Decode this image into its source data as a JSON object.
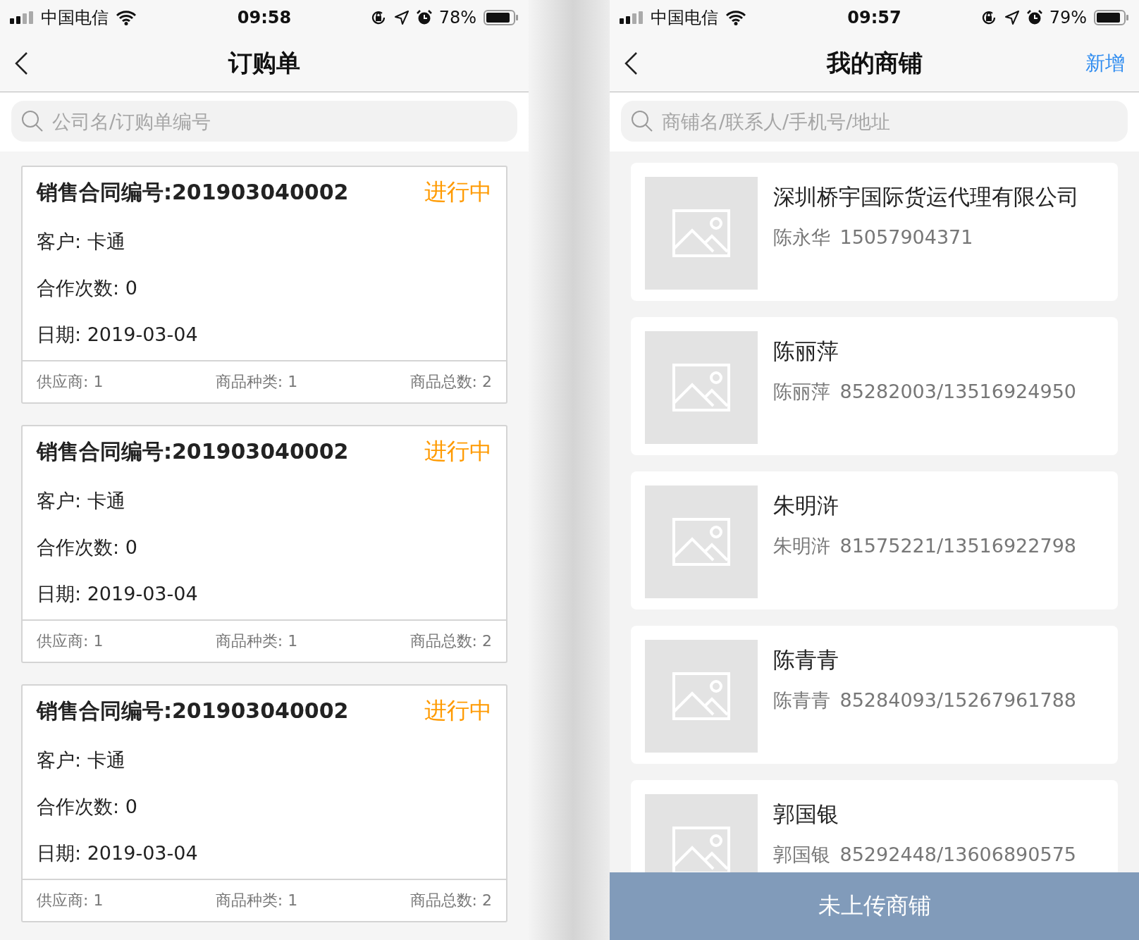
{
  "left_phone": {
    "status_bar": {
      "carrier": "中国电信",
      "time": "09:58",
      "battery": "78%"
    },
    "nav": {
      "title": "订购单"
    },
    "search": {
      "placeholder": "公司名/订购单编号"
    },
    "orders": [
      {
        "title": "销售合同编号:201903040002",
        "status": "进行中",
        "customer": "客户: 卡通",
        "cooperations": "合作次数: 0",
        "date": "日期: 2019-03-04",
        "supplier": "供应商: 1",
        "kinds": "商品种类: 1",
        "total": "商品总数: 2"
      },
      {
        "title": "销售合同编号:201903040002",
        "status": "进行中",
        "customer": "客户: 卡通",
        "cooperations": "合作次数: 0",
        "date": "日期: 2019-03-04",
        "supplier": "供应商: 1",
        "kinds": "商品种类: 1",
        "total": "商品总数: 2"
      },
      {
        "title": "销售合同编号:201903040002",
        "status": "进行中",
        "customer": "客户: 卡通",
        "cooperations": "合作次数: 0",
        "date": "日期: 2019-03-04",
        "supplier": "供应商: 1",
        "kinds": "商品种类: 1",
        "total": "商品总数: 2"
      }
    ]
  },
  "right_phone": {
    "status_bar": {
      "carrier": "中国电信",
      "time": "09:57",
      "battery": "79%"
    },
    "nav": {
      "title": "我的商铺",
      "action": "新增"
    },
    "search": {
      "placeholder": "商铺名/联系人/手机号/地址"
    },
    "shops": [
      {
        "name": "深圳桥宇国际货运代理有限公司",
        "contact": "陈永华",
        "phone": "15057904371"
      },
      {
        "name": "陈丽萍",
        "contact": "陈丽萍",
        "phone": "85282003/13516924950"
      },
      {
        "name": "朱明浒",
        "contact": "朱明浒",
        "phone": "81575221/13516922798"
      },
      {
        "name": "陈青青",
        "contact": "陈青青",
        "phone": "85284093/15267961788"
      },
      {
        "name": "郭国银",
        "contact": "郭国银",
        "phone": "85292448/13606890575"
      }
    ],
    "bottom_button": "未上传商铺"
  }
}
